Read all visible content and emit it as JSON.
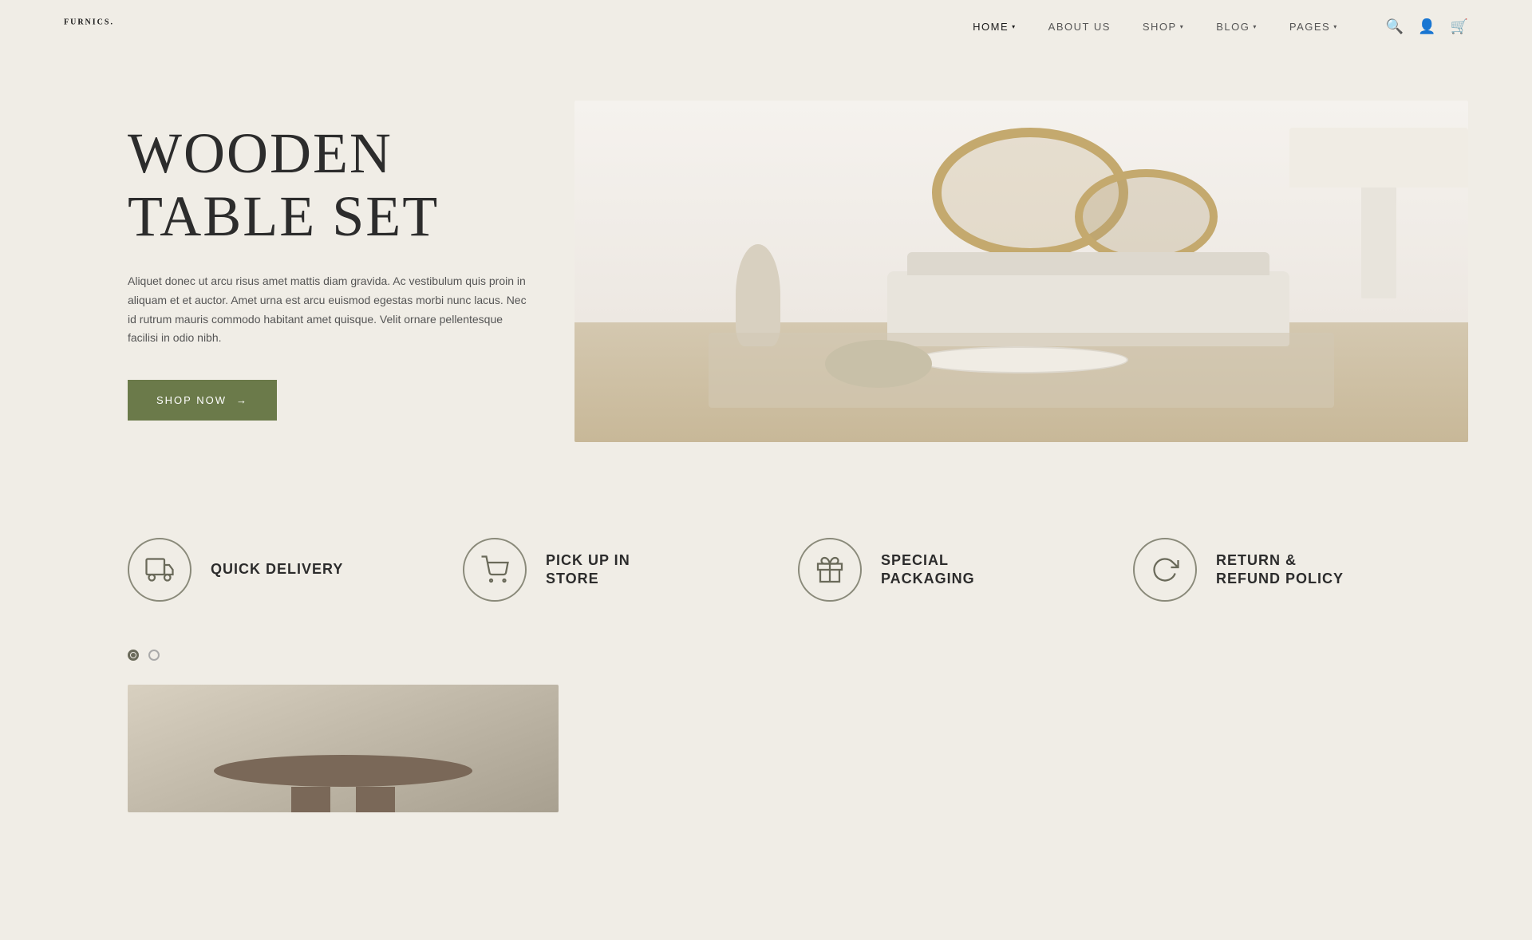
{
  "brand": {
    "name": "FURNICS",
    "dot": "."
  },
  "nav": {
    "items": [
      {
        "label": "HOME",
        "hasDropdown": true,
        "active": true
      },
      {
        "label": "ABOUT US",
        "hasDropdown": false,
        "active": false
      },
      {
        "label": "SHOP",
        "hasDropdown": true,
        "active": false
      },
      {
        "label": "BLOG",
        "hasDropdown": true,
        "active": false
      },
      {
        "label": "PAGES",
        "hasDropdown": true,
        "active": false
      }
    ]
  },
  "hero": {
    "title": "WOODEN TABLE SET",
    "description": "Aliquet donec ut arcu risus amet mattis diam gravida. Ac vestibulum quis proin in aliquam et et auctor. Amet urna est arcu euismod egestas morbi nunc lacus. Nec id rutrum mauris commodo habitant amet quisque. Velit ornare pellentesque facilisi in odio nibh.",
    "cta_label": "SHOP NOW",
    "cta_arrow": "→"
  },
  "features": [
    {
      "id": "quick-delivery",
      "label": "QUICK DELIVERY",
      "icon": "truck"
    },
    {
      "id": "pick-up-in-store",
      "label": "PICK UP IN\nSTORE",
      "label_line1": "PICK UP IN",
      "label_line2": "STORE",
      "icon": "cart"
    },
    {
      "id": "special-packaging",
      "label": "SPECIAL\nPACKAGING",
      "label_line1": "SPECIAL",
      "label_line2": "PACKAGING",
      "icon": "gift"
    },
    {
      "id": "return-refund",
      "label": "RETURN &\nREFUND POLICY",
      "label_line1": "RETURN &",
      "label_line2": "REFUND POLICY",
      "icon": "refresh"
    }
  ],
  "dots": {
    "active_index": 0,
    "count": 2
  },
  "colors": {
    "bg": "#f0ede6",
    "cta_bg": "#6b7a4a",
    "icon_stroke": "#6a6a5a"
  }
}
